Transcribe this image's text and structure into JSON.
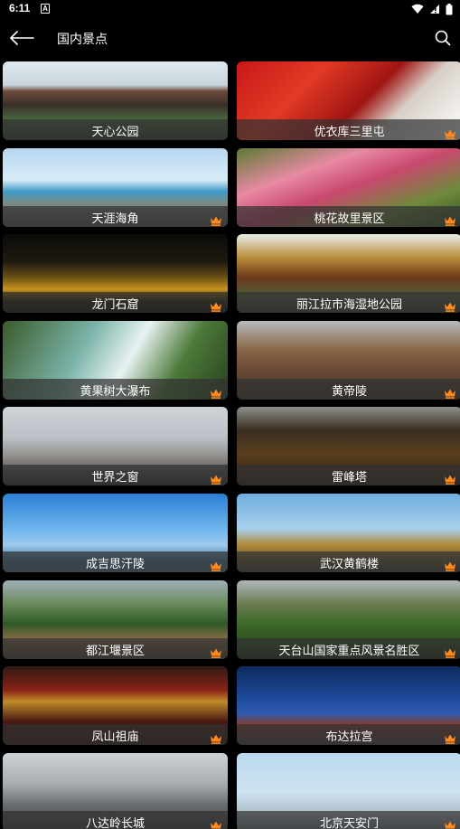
{
  "status": {
    "time": "6:11",
    "badge": "A"
  },
  "header": {
    "title": "国内景点"
  },
  "colors": {
    "crown": "#ff8a1e",
    "caption_bg": "#333333"
  },
  "spots": [
    {
      "name": "天心公园",
      "vip": false
    },
    {
      "name": "优衣库三里屯",
      "vip": true
    },
    {
      "name": "天涯海角",
      "vip": true
    },
    {
      "name": "桃花故里景区",
      "vip": true
    },
    {
      "name": "龙门石窟",
      "vip": true
    },
    {
      "name": "丽江拉市海湿地公园",
      "vip": true
    },
    {
      "name": "黄果树大瀑布",
      "vip": true
    },
    {
      "name": "黄帝陵",
      "vip": true
    },
    {
      "name": "世界之窗",
      "vip": true
    },
    {
      "name": "雷峰塔",
      "vip": true
    },
    {
      "name": "成吉思汗陵",
      "vip": true
    },
    {
      "name": "武汉黄鹤楼",
      "vip": true
    },
    {
      "name": "都江堰景区",
      "vip": true
    },
    {
      "name": "天台山国家重点风景名胜区",
      "vip": true
    },
    {
      "name": "凤山祖庙",
      "vip": true
    },
    {
      "name": "布达拉宫",
      "vip": true
    },
    {
      "name": "八达岭长城",
      "vip": true
    },
    {
      "name": "北京天安门",
      "vip": true
    }
  ]
}
